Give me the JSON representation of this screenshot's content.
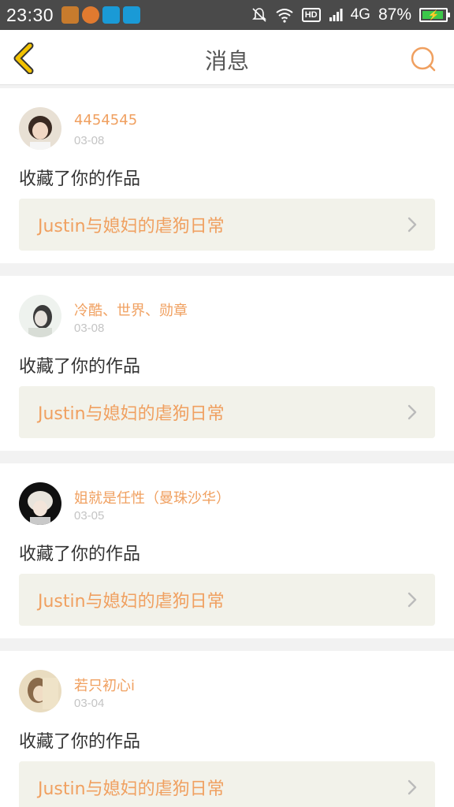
{
  "status_bar": {
    "time": "23:30",
    "hd": "HD",
    "network": "4G",
    "battery": "87%",
    "notification_icons": [
      "taobao-icon",
      "fire-icon",
      "chat-icon",
      "scan-icon"
    ]
  },
  "header": {
    "title": "消息",
    "back_icon": "back-icon",
    "search_icon": "search-icon"
  },
  "messages": [
    {
      "user": "4454545",
      "date": "03-08",
      "action": "收藏了你的作品",
      "work": "Justin与媳妇的虐狗日常"
    },
    {
      "user": "冷酷、世界、勋章",
      "date": "03-08",
      "action": "收藏了你的作品",
      "work": "Justin与媳妇的虐狗日常"
    },
    {
      "user": "姐就是任性（曼珠沙华）",
      "date": "03-05",
      "action": "收藏了你的作品",
      "work": "Justin与媳妇的虐狗日常"
    },
    {
      "user": "若只初心i",
      "date": "03-04",
      "action": "收藏了你的作品",
      "work": "Justin与媳妇的虐狗日常"
    }
  ],
  "colors": {
    "accent": "#f0a060",
    "back_icon": "#f2c200",
    "status_bar": "#4a4a4a"
  }
}
